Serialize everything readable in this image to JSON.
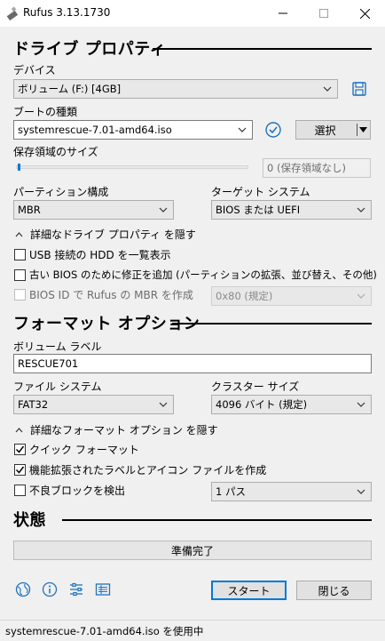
{
  "window": {
    "title": "Rufus 3.13.1730"
  },
  "drive_properties": {
    "heading": "ドライブ プロパティ",
    "device_label": "デバイス",
    "device_value": "ボリューム (F:) [4GB]",
    "boot_type_label": "ブートの種類",
    "boot_type_value": "systemrescue-7.01-amd64.iso",
    "select_button": "選択",
    "persistent_label": "保存領域のサイズ",
    "persistent_value": "0 (保存領域なし)",
    "persistent_level": 0,
    "partition_label": "パーティション構成",
    "partition_value": "MBR",
    "target_label": "ターゲット システム",
    "target_value": "BIOS または UEFI",
    "advanced_toggle": "詳細なドライブ プロパティ を隠す",
    "usb_hdd_label": "USB 接続の HDD を一覧表示",
    "usb_hdd_checked": false,
    "old_bios_label": "古い BIOS のために修正を追加 (パーティションの拡張、並び替え、その他)",
    "old_bios_checked": false,
    "bios_id_label": "BIOS ID で Rufus の MBR を作成",
    "bios_id_checked": false,
    "bios_id_value": "0x80 (規定)"
  },
  "format_options": {
    "heading": "フォーマット オプション",
    "volume_label_label": "ボリューム ラベル",
    "volume_label_value": "RESCUE701",
    "filesystem_label": "ファイル システム",
    "filesystem_value": "FAT32",
    "cluster_label": "クラスター サイズ",
    "cluster_value": "4096 バイト (規定)",
    "advanced_toggle": "詳細なフォーマット オプション を隠す",
    "quick_format_label": "クイック フォーマット",
    "quick_format_checked": true,
    "extended_label_label": "機能拡張されたラベルとアイコン ファイルを作成",
    "extended_label_checked": true,
    "bad_blocks_label": "不良ブロックを検出",
    "bad_blocks_checked": false,
    "bad_blocks_passes": "1 パス"
  },
  "status": {
    "heading": "状態",
    "progress_text": "準備完了",
    "progress_fraction": 0
  },
  "actions": {
    "start_button": "スタート",
    "close_button": "閉じる"
  },
  "statusbar": {
    "text": "systemrescue-7.01-amd64.iso を使用中"
  },
  "colors": {
    "accent": "#0078d7",
    "check_icon": "#1e73be"
  },
  "icons": [
    "app-usb-icon",
    "save-icon",
    "check-circle-icon",
    "globe-icon",
    "info-icon",
    "settings-icon",
    "log-icon",
    "chevron-up-icon",
    "chevron-down-icon"
  ]
}
